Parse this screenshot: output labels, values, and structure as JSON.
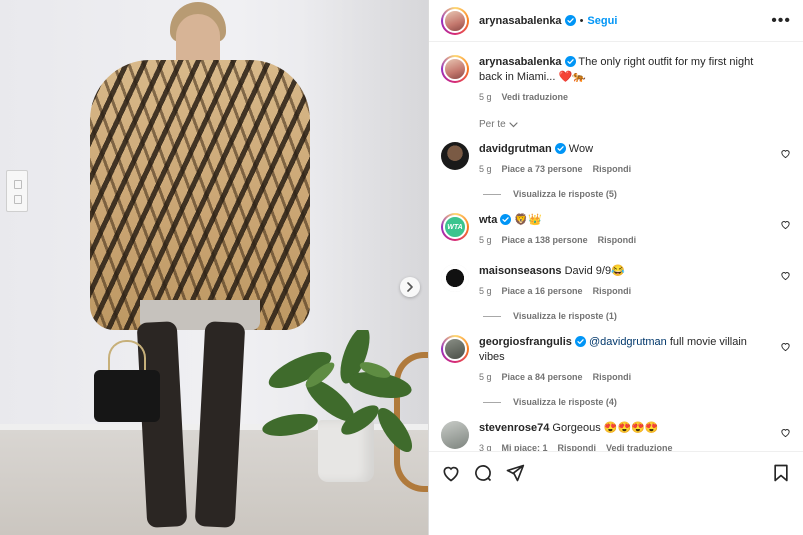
{
  "post": {
    "username": "arynasabalenka",
    "follow_label": "Segui",
    "more_label": "•••",
    "caption": {
      "username": "arynasabalenka",
      "text": "The only right outfit for my first night back in Miami... ❤️🐅",
      "time": "5 g",
      "translate": "Vedi traduzione"
    },
    "filter_label": "Per te"
  },
  "comments": [
    {
      "username": "davidgrutman",
      "verified": true,
      "text": "Wow",
      "time": "5 g",
      "likes": "Piace a 73 persone",
      "reply": "Rispondi",
      "replies": "Visualizza le risposte (5)"
    },
    {
      "username": "wta",
      "verified": true,
      "text": "🦁👑",
      "time": "5 g",
      "likes": "Piace a 138 persone",
      "reply": "Rispondi",
      "replies": ""
    },
    {
      "username": "maisonseasons",
      "verified": false,
      "text": "David 9/9😂",
      "time": "5 g",
      "likes": "Piace a 16 persone",
      "reply": "Rispondi",
      "replies": "Visualizza le risposte (1)"
    },
    {
      "username": "georgiosfrangulis",
      "verified": true,
      "mention": "@davidgrutman",
      "text": " full movie villain vibes",
      "time": "5 g",
      "likes": "Piace a 84 persone",
      "reply": "Rispondi",
      "replies": "Visualizza le risposte (4)"
    },
    {
      "username": "stevenrose74",
      "verified": false,
      "text": "Gorgeous 😍😍😍😍",
      "time": "3 g",
      "likes": "Mi piace: 1",
      "reply": "Rispondi",
      "translate": "Vedi traduzione"
    }
  ],
  "icons": {
    "like": "heart-icon",
    "comment": "comment-icon",
    "share": "share-icon",
    "save": "bookmark-icon",
    "verified": "verified-badge-icon",
    "next": "chevron-right-icon"
  },
  "colors": {
    "accent": "#0095f6",
    "verified": "#0095f6",
    "muted": "#737373",
    "text": "#262626"
  }
}
